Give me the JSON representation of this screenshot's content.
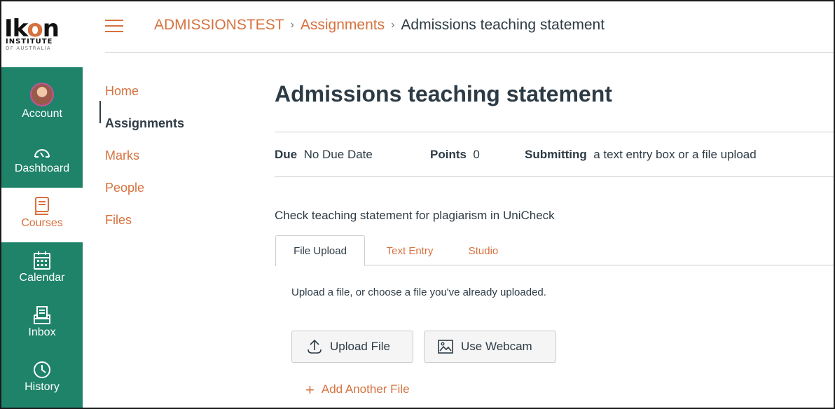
{
  "logo": {
    "wordmark_prefix": "Ik",
    "wordmark_o": "o",
    "wordmark_suffix": "n",
    "line1": "INSTITUTE",
    "line2": "OF AUSTRALIA"
  },
  "global_nav": [
    {
      "label": "Account",
      "icon": "avatar"
    },
    {
      "label": "Dashboard",
      "icon": "dashboard-icon"
    },
    {
      "label": "Courses",
      "icon": "courses-icon",
      "active": true
    },
    {
      "label": "Calendar",
      "icon": "calendar-icon"
    },
    {
      "label": "Inbox",
      "icon": "inbox-icon"
    },
    {
      "label": "History",
      "icon": "history-icon"
    }
  ],
  "breadcrumb": {
    "course": "ADMISSIONSTEST",
    "section": "Assignments",
    "current": "Admissions teaching statement",
    "separator": "›"
  },
  "course_nav": [
    {
      "label": "Home"
    },
    {
      "label": "Assignments",
      "active": true
    },
    {
      "label": "Marks"
    },
    {
      "label": "People"
    },
    {
      "label": "Files"
    }
  ],
  "assignment": {
    "title": "Admissions teaching statement",
    "due_label": "Due",
    "due_value": "No Due Date",
    "points_label": "Points",
    "points_value": "0",
    "submitting_label": "Submitting",
    "submitting_value": "a text entry box or a file upload",
    "description": "Check teaching statement for plagiarism in UniCheck"
  },
  "tabs": [
    {
      "label": "File Upload",
      "active": true
    },
    {
      "label": "Text Entry"
    },
    {
      "label": "Studio"
    }
  ],
  "upload": {
    "hint": "Upload a file, or choose a file you've already uploaded.",
    "upload_button": "Upload File",
    "webcam_button": "Use Webcam",
    "add_another": "Add Another File"
  },
  "colors": {
    "brand": "#d6713e",
    "nav_bg": "#1f8369",
    "text": "#2d3b45"
  }
}
